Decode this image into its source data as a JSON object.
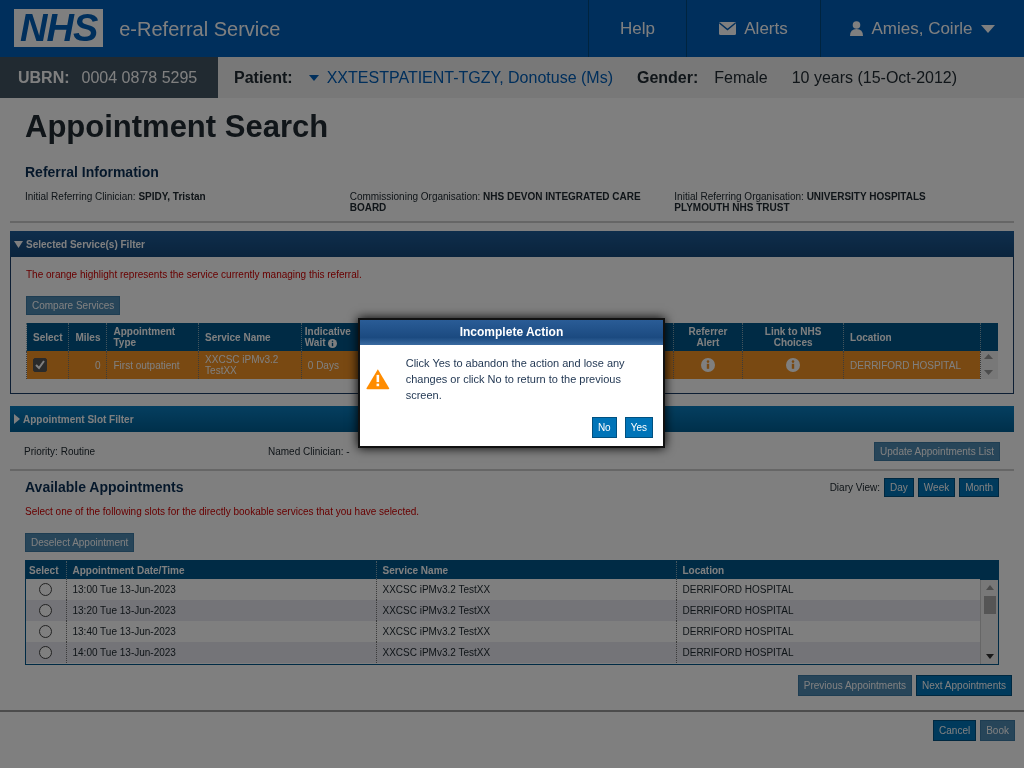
{
  "header": {
    "logo": "NHS",
    "service": "e-Referral Service",
    "nav": [
      {
        "kind": "help",
        "label": "Help"
      },
      {
        "kind": "alerts",
        "label": "Alerts"
      },
      {
        "kind": "user",
        "label": "Amies, Coirle"
      }
    ]
  },
  "patient_bar": {
    "ubrn_label": "UBRN:",
    "ubrn": "0004 0878 5295",
    "patient_label": "Patient:",
    "patient": "XXTESTPATIENT-TGZY, Donotuse (Ms)",
    "gender_label": "Gender:",
    "gender": "Female",
    "age": "10 years (15-Oct-2012)"
  },
  "page_title": "Appointment Search",
  "referral_information": {
    "title": "Referral Information",
    "fields": [
      {
        "label": "Initial Referring Clinician:",
        "value": "SPIDY, Tristan"
      },
      {
        "label": "Commissioning Organisation:",
        "value": "NHS DEVON INTEGRATED CARE BOARD"
      },
      {
        "label": "Initial Referring Organisation:",
        "value": "UNIVERSITY HOSPITALS PLYMOUTH NHS TRUST"
      }
    ]
  },
  "service_filter": {
    "title": "Selected Service(s) Filter",
    "expanded": true,
    "note": "The orange highlight represents the service currently managing this referral.",
    "compare_button": {
      "label": "Compare Services",
      "disabled": true
    },
    "columns": [
      "Select",
      "Miles",
      "Appointment Type",
      "Service Name",
      "Indicative Wait",
      "Referrer Alert",
      "Link to NHS Choices",
      "Location"
    ],
    "rows": [
      {
        "selected": true,
        "current": true,
        "miles": "0",
        "appointment_type": "First outpatient",
        "service_name": "XXCSC iPMv3.2 TestXX",
        "indicative_wait": "0 Days",
        "location": "DERRIFORD HOSPITAL"
      }
    ]
  },
  "slot_filter": {
    "title": "Appointment Slot Filter",
    "expanded": false,
    "priority": "Priority: Routine",
    "named_clinician": "Named Clinician: -",
    "update_button": {
      "label": "Update Appointments List",
      "disabled": true
    }
  },
  "available_appointments": {
    "title": "Available Appointments",
    "diary_label": "Diary View:",
    "views": [
      "Day",
      "Week",
      "Month"
    ],
    "instruction": "Select one of the following slots for the directly bookable services that you have selected.",
    "deselect_button": {
      "label": "Deselect Appointment",
      "disabled": true
    },
    "columns": [
      "Select",
      "Appointment Date/Time",
      "Service Name",
      "Location"
    ],
    "rows": [
      {
        "selected": false,
        "datetime": "13:00 Tue 13-Jun-2023",
        "service_name": "XXCSC iPMv3.2 TestXX",
        "location": "DERRIFORD HOSPITAL"
      },
      {
        "selected": false,
        "datetime": "13:20 Tue 13-Jun-2023",
        "service_name": "XXCSC iPMv3.2 TestXX",
        "location": "DERRIFORD HOSPITAL"
      },
      {
        "selected": false,
        "datetime": "13:40 Tue 13-Jun-2023",
        "service_name": "XXCSC iPMv3.2 TestXX",
        "location": "DERRIFORD HOSPITAL"
      },
      {
        "selected": false,
        "datetime": "14:00 Tue 13-Jun-2023",
        "service_name": "XXCSC iPMv3.2 TestXX",
        "location": "DERRIFORD HOSPITAL"
      }
    ],
    "pager": [
      {
        "label": "Previous Appointments",
        "disabled": true
      },
      {
        "label": "Next Appointments",
        "disabled": false
      }
    ]
  },
  "footer_buttons": [
    {
      "label": "Cancel",
      "disabled": false
    },
    {
      "label": "Book",
      "disabled": true
    }
  ],
  "dialog": {
    "title": "Incomplete Action",
    "message": "Click Yes to abandon the action and lose any changes or click No to return to the previous screen.",
    "buttons": [
      "No",
      "Yes"
    ]
  }
}
